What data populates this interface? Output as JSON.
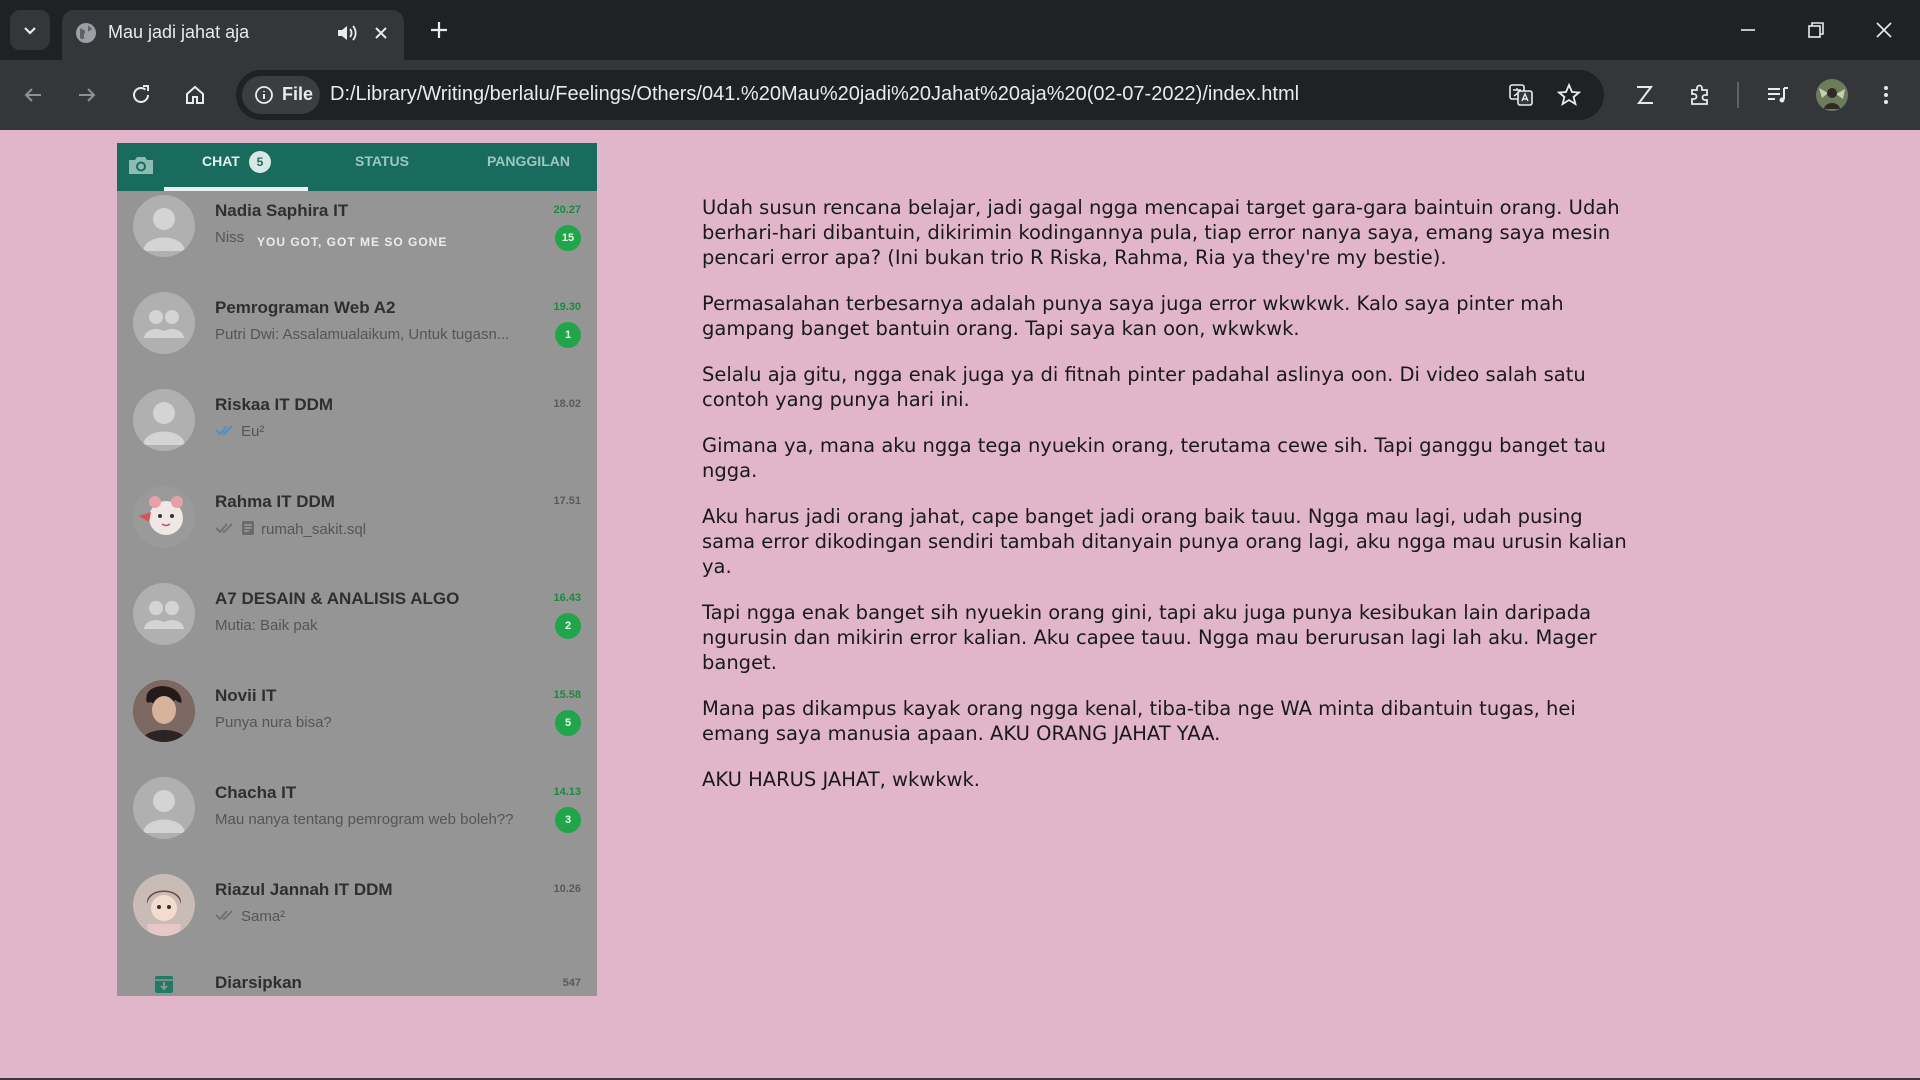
{
  "browser": {
    "tab_title": "Mau jadi jahat aja",
    "scheme_label": "File",
    "url": "D:/Library/Writing/berlalu/Feelings/Others/041.%20Mau%20jadi%20Jahat%20aja%20(02-07-2022)/index.html"
  },
  "whatsapp": {
    "tabs": {
      "chat": "CHAT",
      "chat_badge": "5",
      "status": "STATUS",
      "calls": "PANGGILAN"
    },
    "caption": "YOU GOT, GOT ME SO GONE",
    "accent": "#196b5d",
    "unread_color": "#21a54a",
    "chats": [
      {
        "name": "Nadia Saphira IT",
        "message": "Niss",
        "time": "20.27",
        "unread": "15"
      },
      {
        "name": "Pemrograman Web A2",
        "message": "Putri Dwi: Assalamualaikum, Untuk tugasn...",
        "time": "19.30",
        "unread": "1"
      },
      {
        "name": "Riskaa IT DDM",
        "message": "Eu²",
        "time": "18.02",
        "unread": ""
      },
      {
        "name": "Rahma IT DDM",
        "message": "rumah_sakit.sql",
        "time": "17.51",
        "unread": ""
      },
      {
        "name": "A7 DESAIN & ANALISIS ALGO",
        "message": "Mutia: Baik pak",
        "time": "16.43",
        "unread": "2"
      },
      {
        "name": "Novii IT",
        "message": "Punya nura bisa?",
        "time": "15.58",
        "unread": "5"
      },
      {
        "name": "Chacha IT",
        "message": "Mau nanya tentang pemrogram web boleh??",
        "time": "14.13",
        "unread": "3"
      },
      {
        "name": "Riazul Jannah IT DDM",
        "message": "Sama²",
        "time": "10.26",
        "unread": ""
      }
    ],
    "archived": {
      "label": "Diarsipkan",
      "count": "547"
    }
  },
  "article": {
    "paragraphs": [
      "Udah susun rencana belajar, jadi gagal ngga mencapai target gara-gara baintuin orang. Udah berhari-hari dibantuin, dikirimin kodingannya pula, tiap error nanya saya, emang saya mesin pencari error apa? (Ini bukan trio R Riska, Rahma, Ria ya they're my bestie).",
      "Permasalahan terbesarnya adalah punya saya juga error wkwkwk. Kalo saya pinter mah gampang banget bantuin orang. Tapi saya kan oon, wkwkwk.",
      "Selalu aja gitu, ngga enak juga ya di fitnah pinter padahal aslinya oon. Di video salah satu contoh yang punya hari ini.",
      "Gimana ya, mana aku ngga tega nyuekin orang, terutama cewe sih. Tapi ganggu banget tau ngga.",
      "Aku harus jadi orang jahat, cape banget jadi orang baik tauu. Ngga mau lagi, udah pusing sama error dikodingan sendiri tambah ditanyain punya orang lagi, aku ngga mau urusin kalian ya.",
      "Tapi ngga enak banget sih nyuekin orang gini, tapi aku juga punya kesibukan lain daripada ngurusin dan mikirin error kalian. Aku capee tauu. Ngga mau berurusan lagi lah aku. Mager banget.",
      "Mana pas dikampus kayak orang ngga kenal, tiba-tiba nge WA minta dibantuin tugas, hei emang saya manusia apaan. AKU ORANG JAHAT YAA.",
      "AKU HARUS JAHAT, wkwkwk."
    ]
  },
  "theme": {
    "page_background": "#e1b6cb",
    "chrome_dark": "#202124",
    "chrome_toolbar": "#35363a"
  }
}
